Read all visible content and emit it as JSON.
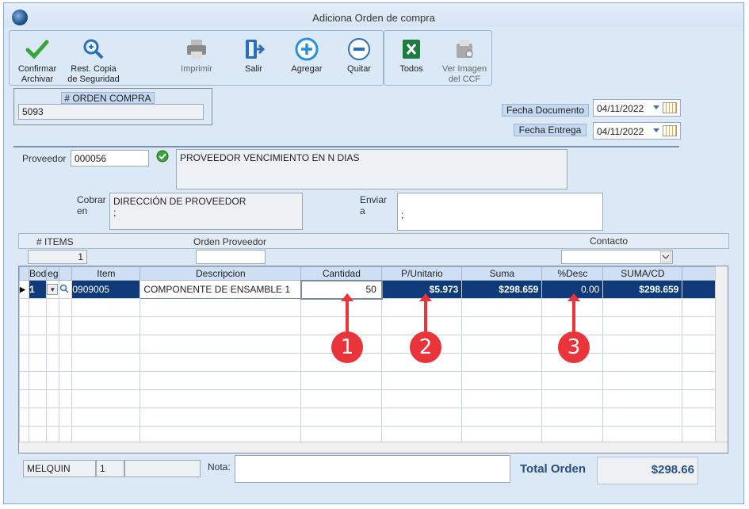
{
  "window": {
    "title": "Adiciona Orden de compra"
  },
  "toolbar": {
    "confirm_label": "Confirmar Archivar",
    "restore_label": "Rest. Copia de Seguridad",
    "print_label": "Imprimir",
    "exit_label": "Salir",
    "add_label": "Agregar",
    "remove_label": "Quitar",
    "all_label": "Todos",
    "view_image_label": "Ver Imagen del CCF"
  },
  "order": {
    "label": "# ORDEN COMPRA",
    "value": "5093"
  },
  "dates": {
    "doc_label": "Fecha Documento",
    "doc_value": "04/11/2022",
    "delivery_label": "Fecha Entrega",
    "delivery_value": "04/11/2022"
  },
  "supplier": {
    "label": "Proveedor",
    "code": "000056",
    "name": "PROVEEDOR VENCIMIENTO EN N DIAS",
    "charge_label": "Cobrar en",
    "charge_value_1": "DIRECCIÓN DE PROVEEDOR",
    "charge_value_2": ";",
    "ship_label": "Enviar a",
    "ship_value": ";"
  },
  "info": {
    "items_label": "# ITEMS",
    "items_value": "1",
    "po_label": "Orden Proveedor",
    "po_value": "",
    "contact_label": "Contacto",
    "contact_value": ""
  },
  "grid": {
    "columns": [
      "Bod",
      "eg",
      "",
      "Item",
      "Descripcion",
      "Cantidad",
      "P/Unitario",
      "Suma",
      "%Desc",
      "SUMA/CD"
    ],
    "rows": [
      {
        "bod": "1",
        "item": "0909005",
        "desc": "COMPONENTE DE ENSAMBLE 1",
        "qty": "50",
        "price": "$5.973",
        "sum": "$298.659",
        "disc": "0.00",
        "sumcd": "$298.659"
      }
    ]
  },
  "callouts": {
    "one": "1",
    "two": "2",
    "three": "3"
  },
  "footer": {
    "user": "MELQUIN",
    "num": "1",
    "extra": "",
    "note_label": "Nota:",
    "note_value": "",
    "total_label": "Total Orden",
    "total_value": "$298.66"
  },
  "colors": {
    "accent": "#0f3b7a",
    "callout": "#e8343a",
    "panel": "#dbe8f6"
  },
  "icons": [
    "app-globe-icon",
    "check-icon",
    "magnifier-icon",
    "printer-icon",
    "exit-door-icon",
    "plus-circle-icon",
    "minus-circle-icon",
    "excel-icon",
    "scanner-icon",
    "calendar-icon",
    "green-check-icon",
    "dropdown-icon"
  ]
}
